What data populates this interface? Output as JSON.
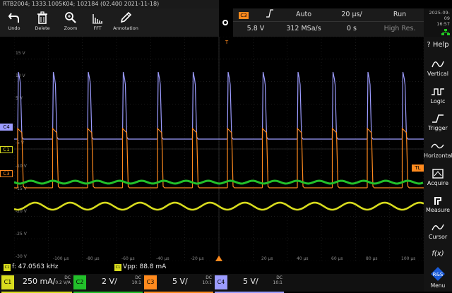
{
  "window": {
    "title": "RTB2004; 1333.1005K04; 102184 (02.400 2021-11-18)"
  },
  "toolbar": [
    {
      "label": "Undo",
      "icon": "undo-icon"
    },
    {
      "label": "Delete",
      "icon": "trash-icon"
    },
    {
      "label": "Zoom",
      "icon": "zoom-icon"
    },
    {
      "label": "FFT",
      "icon": "fft-icon"
    },
    {
      "label": "Annotation",
      "icon": "pencil-icon"
    }
  ],
  "trigger": {
    "source": "C3",
    "slope_icon": "rising-edge-icon",
    "mode": "Auto",
    "timebase": "20 µs/",
    "run_state": "Run",
    "level": "5.8 V",
    "sample_rate": "312 MSa/s",
    "offset": "0 s",
    "resolution": "High Res."
  },
  "datetime": {
    "date": "2025-09-09",
    "time": "16:57"
  },
  "sidebar": [
    {
      "label": "Help",
      "icon": "help-icon"
    },
    {
      "label": "Vertical",
      "icon": "vertical-wave-icon"
    },
    {
      "label": "Logic",
      "icon": "logic-icon"
    },
    {
      "label": "Trigger",
      "icon": "trigger-edge-icon"
    },
    {
      "label": "Horizontal",
      "icon": "horizontal-wave-icon"
    },
    {
      "label": "Acquire",
      "icon": "acquire-icon"
    },
    {
      "label": "Measure",
      "icon": "measure-icon"
    },
    {
      "label": "Cursor",
      "icon": "cursor-icon"
    },
    {
      "label": "Menu",
      "icon": "rs-logo-icon"
    }
  ],
  "waveform": {
    "y_labels": [
      "15 V",
      "10 V",
      "5 V",
      "-5 V",
      "-10 V",
      "-15 V",
      "-20 V",
      "-25 V",
      "-30 V"
    ],
    "x_labels": [
      "-100 µs",
      "-80 µs",
      "-60 µs",
      "-40 µs",
      "-20 µs",
      "20 µs",
      "40 µs",
      "60 µs",
      "80 µs",
      "100 µs"
    ],
    "channel_markers": [
      "C4",
      "C1",
      "C3"
    ],
    "trigger_level_marker": "TL",
    "trigger_pos_marker": "T",
    "colors": {
      "C1": "#d8dc1e",
      "C2": "#22c02a",
      "C3": "#ff8a1e",
      "C4": "#9c9cff",
      "grid": "#2a2a2a"
    }
  },
  "measurements": {
    "m1_badge": "C1",
    "m1_text": "f: 47.0563 kHz",
    "m2_badge": "C1",
    "m2_text": "Vpp: 88.8 mA"
  },
  "channels": [
    {
      "name": "C1",
      "scale": "250 mA/",
      "coupling": "DC",
      "probe": "0.2 V/A",
      "color": "#d8dc1e"
    },
    {
      "name": "C2",
      "scale": "2 V/",
      "coupling": "DC",
      "probe": "10:1",
      "color": "#22c02a"
    },
    {
      "name": "C3",
      "scale": "5 V/",
      "coupling": "DC",
      "probe": "10:1",
      "color": "#ff8a1e"
    },
    {
      "name": "C4",
      "scale": "5 V/",
      "coupling": "DC",
      "probe": "10:1",
      "color": "#9c9cff"
    }
  ]
}
